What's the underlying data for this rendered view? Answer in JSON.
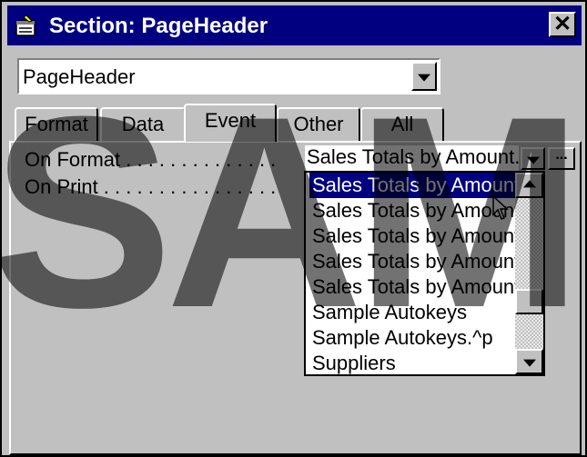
{
  "window": {
    "title": "Section: PageHeader",
    "close_label": "✕",
    "title_icon": "properties-sheet-icon"
  },
  "selector": {
    "value": "PageHeader"
  },
  "tabs": [
    {
      "label": "Format"
    },
    {
      "label": "Data"
    },
    {
      "label": "Event",
      "active": true
    },
    {
      "label": "Other"
    },
    {
      "label": "All"
    }
  ],
  "properties": [
    {
      "label": "On Format . . . . . . . . . . . . . .",
      "value": "Sales Totals by Amount.Pa"
    },
    {
      "label": "On Print  . . . . . . . . . . . . . . . .",
      "value": ""
    }
  ],
  "builder_label": "...",
  "dropdown": {
    "items": [
      "Sales Totals by Amount",
      "Sales Totals by Amount",
      "Sales Totals by Amount",
      "Sales Totals by Amount",
      "Sales Totals by Amount",
      "Sample Autokeys",
      "Sample Autokeys.^p",
      "Suppliers"
    ],
    "selected_index": 0
  },
  "watermark": "SAM",
  "colors": {
    "titlebar": "#000080",
    "selection": "#000080",
    "face": "#c0c0c0"
  }
}
